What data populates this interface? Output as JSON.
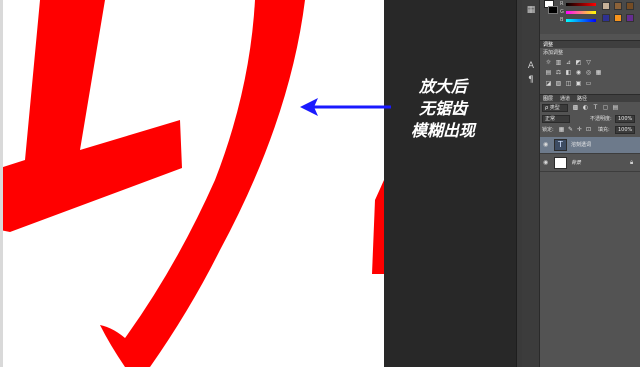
{
  "annotation": {
    "lines": [
      "放大后",
      "无锯齿",
      "模糊出现"
    ],
    "arrow_color": "#1a1aff"
  },
  "canvas": {
    "background": "#ffffff",
    "glyph_color": "#ff0000"
  },
  "color_panel": {
    "slider_labels": [
      "R",
      "G",
      "B"
    ],
    "foreground": "#ffffff",
    "background": "#000000"
  },
  "adjustments": {
    "tab_label": "调整",
    "add_label": "添加调整",
    "icons_row1": [
      "brightness-icon",
      "levels-icon",
      "curves-icon",
      "exposure-icon",
      "vibrance-icon",
      "gradient-map-icon"
    ],
    "icons_row2": [
      "hue-sat-icon",
      "color-balance-icon",
      "bw-icon",
      "photo-filter-icon",
      "channel-mixer-icon",
      "color-lookup-icon"
    ],
    "icons_row3": [
      "invert-icon",
      "posterize-icon",
      "threshold-icon",
      "selective-color-icon",
      "gradient-icon"
    ]
  },
  "layers": {
    "tabs": [
      "图层",
      "通道",
      "路径"
    ],
    "filter_label": "ρ 类型",
    "blend_mode": "正常",
    "opacity_label": "不透明度:",
    "opacity_value": "100%",
    "lock_label": "锁定:",
    "fill_label": "填充:",
    "fill_value": "100%",
    "items": [
      {
        "name": "溶刻透词",
        "thumb": "T",
        "selected": true
      },
      {
        "name": "背景",
        "thumb": "",
        "selected": false
      }
    ]
  },
  "tools": [
    "A",
    "¶"
  ]
}
